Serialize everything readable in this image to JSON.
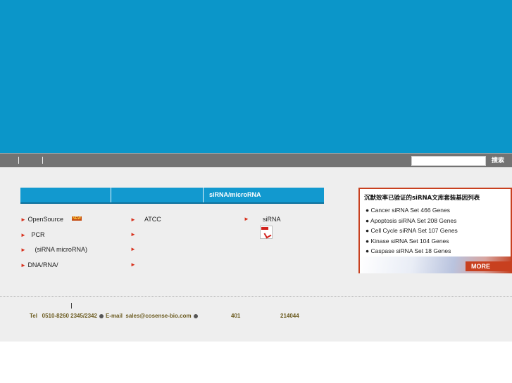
{
  "nav": {
    "search_placeholder": "",
    "search_button": "搜索"
  },
  "tabs": [
    {
      "label": ""
    },
    {
      "label": ""
    },
    {
      "label": "siRNA/microRNA"
    }
  ],
  "links": {
    "col1": [
      "OpenSource",
      "PCR",
      "(siRNA microRNA)",
      "DNA/RNA/"
    ],
    "col2": [
      "ATCC"
    ],
    "col3": [
      "siRNA"
    ],
    "new_badge": "NEW"
  },
  "library_box": {
    "title": "沉默效率已验证的siRNA文库套装基因列表",
    "items": [
      "Cancer siRNA Set 466 Genes",
      "Apoptosis siRNA Set 208 Genes",
      "Cell Cycle siRNA Set 107 Genes",
      "Kinase siRNA Set 104 Genes",
      "Caspase siRNA Set 18 Genes"
    ],
    "more_label": "MORE"
  },
  "footer": {
    "tel_label": "Tel",
    "tel": "0510-8260 2345/2342",
    "email_label": "E-mail",
    "email": "sales@cosense-bio.com",
    "room": "401",
    "postcode": "214044"
  },
  "colors": {
    "banner": "#0b96c9",
    "navbar": "#737373",
    "accent": "#c8401f",
    "tab_blue": "#1299cf"
  }
}
